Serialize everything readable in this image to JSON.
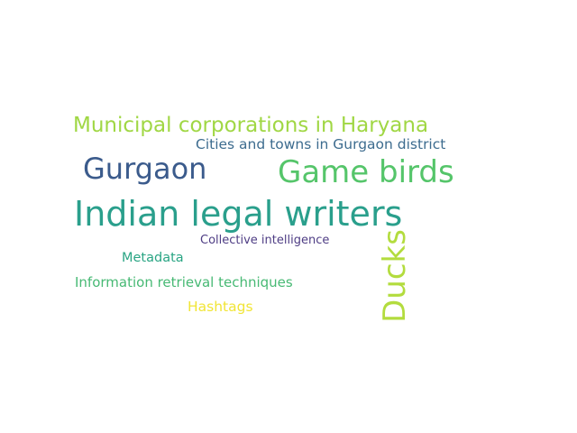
{
  "word_cloud": {
    "words": [
      {
        "id": "municipal",
        "text": "Municipal corporations in Haryana",
        "color": "#a0d744"
      },
      {
        "id": "cities",
        "text": "Cities and towns in Gurgaon district",
        "color": "#3d6c8f"
      },
      {
        "id": "gurgaon",
        "text": "Gurgaon",
        "color": "#3b5b8c"
      },
      {
        "id": "gamebirds",
        "text": "Game birds",
        "color": "#55c56a"
      },
      {
        "id": "indian",
        "text": "Indian legal writers",
        "color": "#2a9f8c"
      },
      {
        "id": "collective",
        "text": "Collective intelligence",
        "color": "#4e3d84"
      },
      {
        "id": "metadata",
        "text": "Metadata",
        "color": "#2aa584"
      },
      {
        "id": "info",
        "text": "Information retrieval techniques",
        "color": "#47b974"
      },
      {
        "id": "hashtags",
        "text": "Hashtags",
        "color": "#f1e536"
      },
      {
        "id": "ducks",
        "text": "Ducks",
        "color": "#b3dc3e",
        "orientation": "vertical"
      }
    ]
  }
}
